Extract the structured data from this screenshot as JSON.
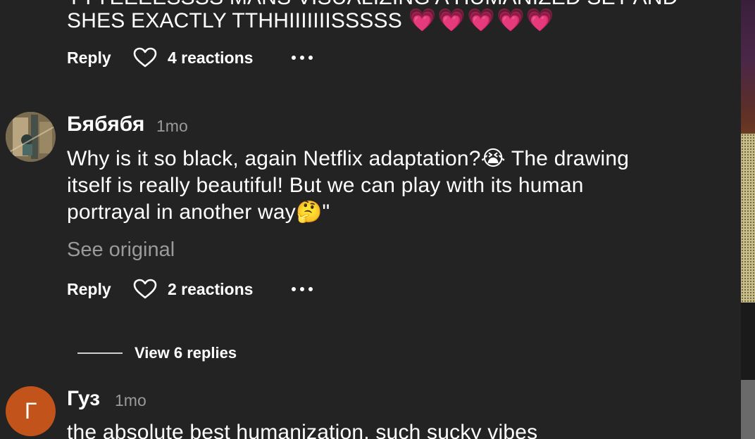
{
  "comment_top": {
    "text_line_1_cut": "YYYEEEESSSS MANS VISUALIZING A HUMANIZED SET AND",
    "text_line_2": "SHES EXACTLY TTHHIIIIIIISSSSS",
    "hearts": "💗💗💗💗💗",
    "reply_label": "Reply",
    "reactions_label": "4 reactions"
  },
  "comment_1": {
    "author": "Бябябя",
    "time": "1mo",
    "line_1": "Why is it so black, again Netflix adaptation?",
    "emoji_1": "😭",
    "line_1_rest": " The drawing",
    "line_2": "itself is really beautiful! But we can play with its human",
    "line_3": "portrayal in another way",
    "emoji_2": "🤔",
    "line_3_rest": "\"",
    "see_original": "See original",
    "reply_label": "Reply",
    "reactions_label": "2 reactions",
    "view_replies": "View 6 replies"
  },
  "comment_2": {
    "author": "Гуз",
    "time": "1mo",
    "avatar_letter": "Г",
    "avatar_color": "#c2531b",
    "line_1": "the absolute best humanization, such sucky vibes"
  },
  "colors": {
    "background": "#232323",
    "text": "#ffffff",
    "muted": "#9a9a9a",
    "heart_emoji": "#e94ba3"
  },
  "icons": [
    "heart-outline-icon",
    "more-horizontal-icon"
  ]
}
